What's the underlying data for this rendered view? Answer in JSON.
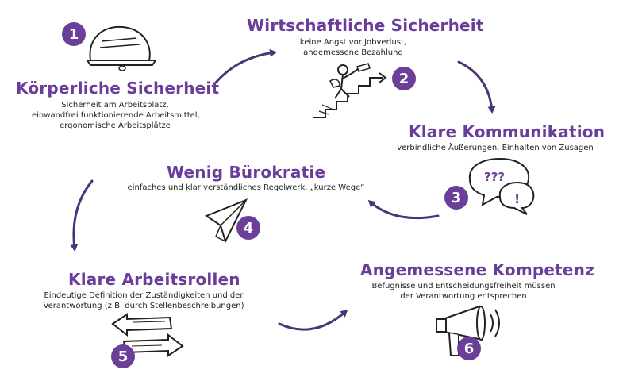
{
  "colors": {
    "accent": "#6b3f97",
    "title": "#6a3d9a",
    "text": "#222222"
  },
  "items": [
    {
      "number": "1",
      "title": "Körperliche Sicherheit",
      "lines": [
        "Sicherheit am Arbeitsplatz,",
        "einwandfrei funktionierende Arbeitsmittel,",
        "ergonomische Arbeitsplätze"
      ],
      "icon": "helmet-icon"
    },
    {
      "number": "2",
      "title": "Wirtschaftliche Sicherheit",
      "lines": [
        "keine Angst vor Jobverlust,",
        "angemessene Bezahlung"
      ],
      "icon": "climbing-person-icon"
    },
    {
      "number": "3",
      "title": "Klare Kommunikation",
      "lines": [
        "verbindliche Äußerungen, Einhalten von Zusagen"
      ],
      "icon": "speech-bubbles-icon",
      "bubble_texts": [
        "???",
        "!"
      ]
    },
    {
      "number": "4",
      "title": "Wenig Bürokratie",
      "lines": [
        "einfaches und klar verständliches Regelwerk, „kurze Wege“"
      ],
      "icon": "paper-plane-icon"
    },
    {
      "number": "5",
      "title": "Klare Arbeitsrollen",
      "lines": [
        "Eindeutige Definition der Zuständigkeiten und der",
        "Verantwortung (z.B. durch Stellenbeschreibungen)"
      ],
      "icon": "double-arrow-icon"
    },
    {
      "number": "6",
      "title": "Angemessene Kompetenz",
      "lines": [
        "Befugnisse und Entscheidungsfreiheit müssen",
        "der Verantwortung entsprechen"
      ],
      "icon": "megaphone-icon"
    }
  ]
}
